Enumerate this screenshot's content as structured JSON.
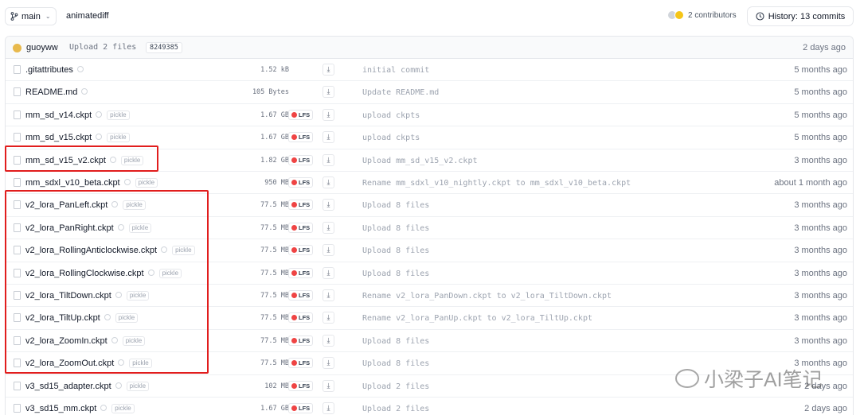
{
  "header": {
    "branch": "main",
    "repo": "animatediff",
    "contributors": "2 contributors",
    "history": "History: 13 commits"
  },
  "last_commit": {
    "user": "guoyww",
    "message": "Upload 2 files",
    "hash": "8249385",
    "time": "2 days ago"
  },
  "files": [
    {
      "name": ".gitattributes",
      "pickle": false,
      "size": "1.52 kB",
      "lfs": false,
      "commit": "initial commit",
      "time": "5 months ago"
    },
    {
      "name": "README.md",
      "pickle": false,
      "size": "105 Bytes",
      "lfs": false,
      "commit": "Update README.md",
      "time": "5 months ago"
    },
    {
      "name": "mm_sd_v14.ckpt",
      "pickle": true,
      "size": "1.67 GB",
      "lfs": true,
      "commit": "upload ckpts",
      "time": "5 months ago"
    },
    {
      "name": "mm_sd_v15.ckpt",
      "pickle": true,
      "size": "1.67 GB",
      "lfs": true,
      "commit": "upload ckpts",
      "time": "5 months ago"
    },
    {
      "name": "mm_sd_v15_v2.ckpt",
      "pickle": true,
      "size": "1.82 GB",
      "lfs": true,
      "commit": "Upload mm_sd_v15_v2.ckpt",
      "time": "3 months ago"
    },
    {
      "name": "mm_sdxl_v10_beta.ckpt",
      "pickle": true,
      "size": "950 MB",
      "lfs": true,
      "commit": "Rename mm_sdxl_v10_nightly.ckpt to mm_sdxl_v10_beta.ckpt",
      "time": "about 1 month ago"
    },
    {
      "name": "v2_lora_PanLeft.ckpt",
      "pickle": true,
      "size": "77.5 MB",
      "lfs": true,
      "commit": "Upload 8 files",
      "time": "3 months ago"
    },
    {
      "name": "v2_lora_PanRight.ckpt",
      "pickle": true,
      "size": "77.5 MB",
      "lfs": true,
      "commit": "Upload 8 files",
      "time": "3 months ago"
    },
    {
      "name": "v2_lora_RollingAnticlockwise.ckpt",
      "pickle": true,
      "size": "77.5 MB",
      "lfs": true,
      "commit": "Upload 8 files",
      "time": "3 months ago"
    },
    {
      "name": "v2_lora_RollingClockwise.ckpt",
      "pickle": true,
      "size": "77.5 MB",
      "lfs": true,
      "commit": "Upload 8 files",
      "time": "3 months ago"
    },
    {
      "name": "v2_lora_TiltDown.ckpt",
      "pickle": true,
      "size": "77.5 MB",
      "lfs": true,
      "commit": "Rename v2_lora_PanDown.ckpt to v2_lora_TiltDown.ckpt",
      "time": "3 months ago"
    },
    {
      "name": "v2_lora_TiltUp.ckpt",
      "pickle": true,
      "size": "77.5 MB",
      "lfs": true,
      "commit": "Rename v2_lora_PanUp.ckpt to v2_lora_TiltUp.ckpt",
      "time": "3 months ago"
    },
    {
      "name": "v2_lora_ZoomIn.ckpt",
      "pickle": true,
      "size": "77.5 MB",
      "lfs": true,
      "commit": "Upload 8 files",
      "time": "3 months ago"
    },
    {
      "name": "v2_lora_ZoomOut.ckpt",
      "pickle": true,
      "size": "77.5 MB",
      "lfs": true,
      "commit": "Upload 8 files",
      "time": "3 months ago"
    },
    {
      "name": "v3_sd15_adapter.ckpt",
      "pickle": true,
      "size": "102 MB",
      "lfs": true,
      "commit": "Upload 2 files",
      "time": "2 days ago"
    },
    {
      "name": "v3_sd15_mm.ckpt",
      "pickle": true,
      "size": "1.67 GB",
      "lfs": true,
      "commit": "Upload 2 files",
      "time": "2 days ago"
    }
  ],
  "labels": {
    "pickle": "pickle",
    "lfs": "LFS"
  },
  "watermark": "小梁子AI笔记",
  "colors": {
    "highlight": "#e11d1d",
    "lfs_badge": "#ef4444",
    "avatar": "#e8b94c"
  }
}
